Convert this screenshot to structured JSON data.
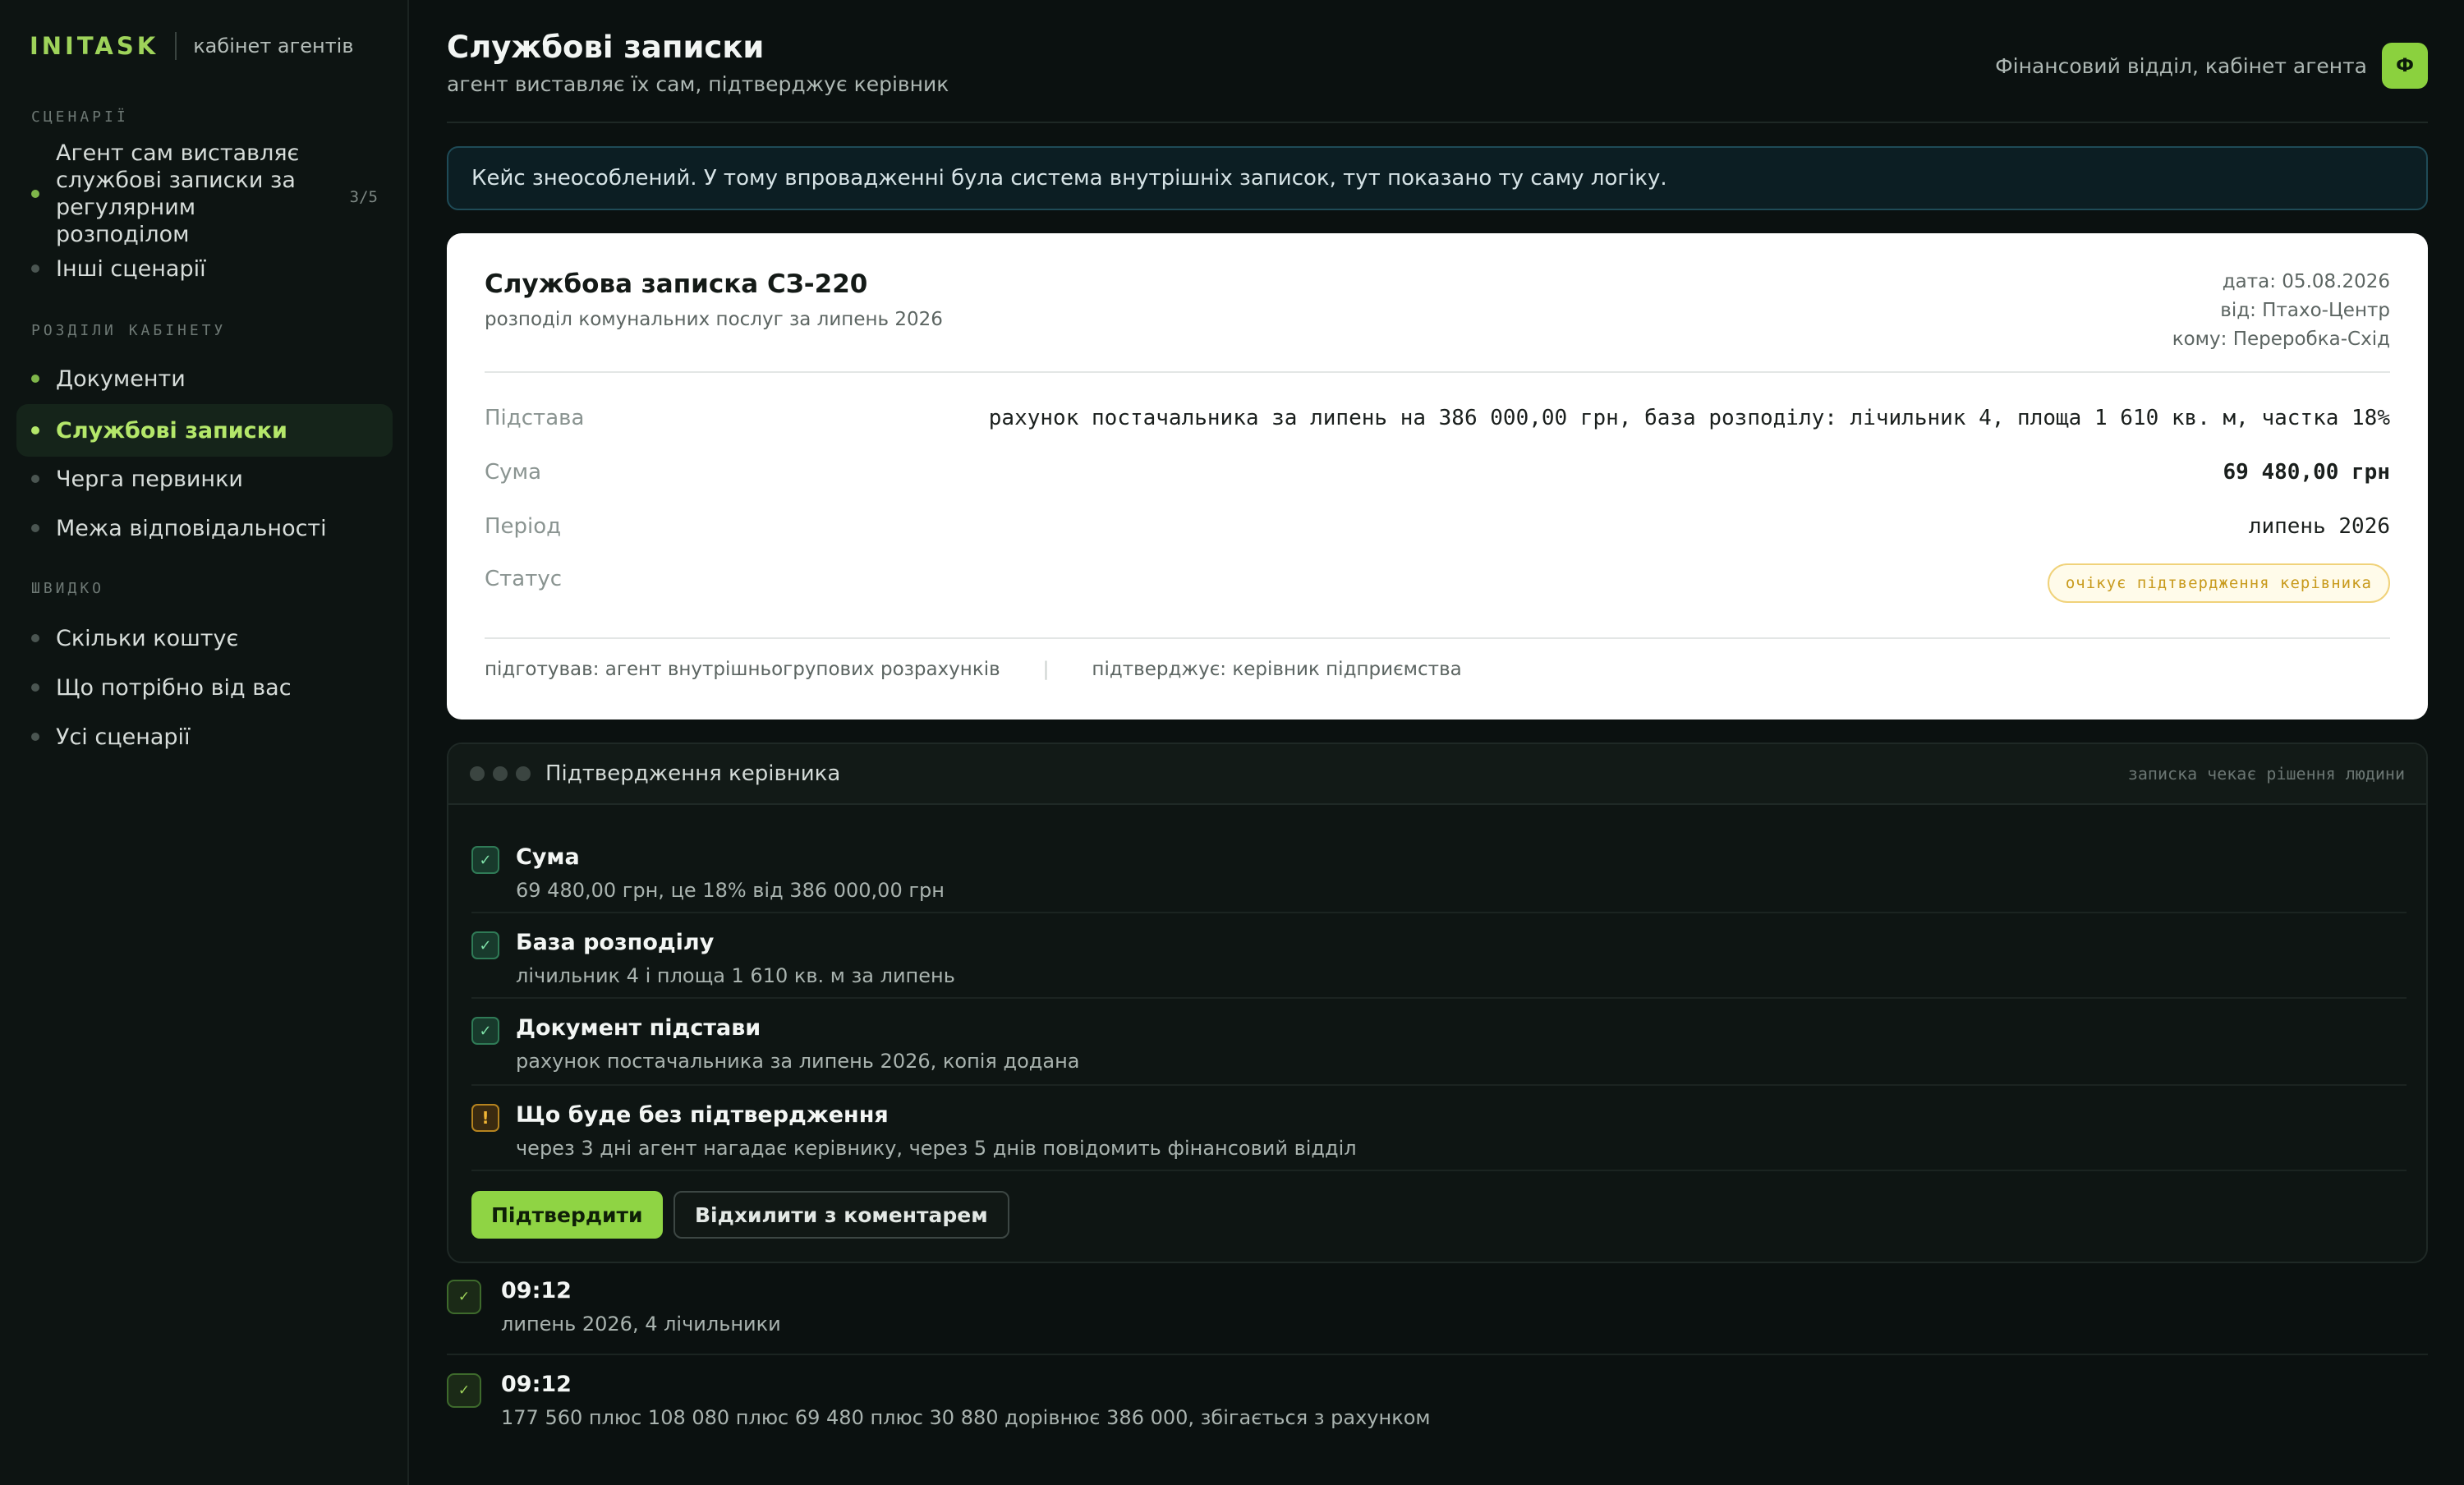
{
  "brand": {
    "logo": "INITASK",
    "subtitle": "кабінет агентів"
  },
  "sidebar": {
    "sections": [
      {
        "title": "СЦЕНАРІЇ",
        "items": [
          {
            "label": "Агент сам виставляє службові записки за регулярним розподілом",
            "count": "3/5"
          },
          {
            "label": "Інші сценарії"
          }
        ]
      },
      {
        "title": "РОЗДІЛИ КАБІНЕТУ",
        "items": [
          {
            "label": "Документи"
          },
          {
            "label": "Службові записки"
          },
          {
            "label": "Черга первинки"
          },
          {
            "label": "Межа відповідальності"
          }
        ]
      },
      {
        "title": "ШВИДКО",
        "items": [
          {
            "label": "Скільки коштує"
          },
          {
            "label": "Що потрібно від вас"
          },
          {
            "label": "Усі сценарії"
          }
        ]
      }
    ]
  },
  "header": {
    "title": "Службові записки",
    "subtitle": "агент виставляє їх сам, підтверджує керівник",
    "user_label": "Фінансовий відділ, кабінет агента",
    "avatar_letter": "Ф"
  },
  "notice": "Кейс знеособлений. У тому впровадженні була система внутрішніх записок, тут показано ту саму логіку.",
  "memo": {
    "title": "Службова записка СЗ-220",
    "subtitle": "розподіл комунальних послуг за липень 2026",
    "date": "дата: 05.08.2026",
    "from": "від: Птахо-Центр",
    "to": "кому: Переробка-Схід",
    "rows": [
      {
        "label": "Підстава",
        "value": "рахунок постачальника за липень на 386 000,00 грн, база розподілу: лічильник 4, площа 1 610 кв. м, частка 18%"
      },
      {
        "label": "Сума",
        "value": "69 480,00 грн"
      },
      {
        "label": "Період",
        "value": "липень 2026"
      },
      {
        "label": "Статус",
        "value": "очікує підтвердження керівника"
      }
    ],
    "prepared_by": "підготував: агент внутрішньогрупових розрахунків",
    "separator": "|",
    "approved_by": "підтверджує: керівник підприємства"
  },
  "approval": {
    "title": "Підтвердження керівника",
    "note": "записка чекає рішення людини",
    "checks": [
      {
        "title": "Сума",
        "desc": "69 480,00 грн, це 18% від 386 000,00 грн",
        "mark": "✓"
      },
      {
        "title": "База розподілу",
        "desc": "лічильник 4 і площа 1 610 кв. м за липень",
        "mark": "✓"
      },
      {
        "title": "Документ підстави",
        "desc": "рахунок постачальника за липень 2026, копія додана",
        "mark": "✓"
      },
      {
        "title": "Що буде без підтвердження",
        "desc": "через 3 дні агент нагадає керівнику, через 5 днів повідомить фінансовий відділ",
        "mark": "!"
      }
    ],
    "confirm_label": "Підтвердити",
    "reject_label": "Відхилити з коментарем"
  },
  "log": [
    {
      "mark": "✓",
      "time": "09:12",
      "desc": "липень 2026, 4 лічильники"
    },
    {
      "mark": "✓",
      "time": "09:12",
      "desc": "177 560 плюс 108 080 плюс 69 480 плюс 30 880 дорівнює 386 000, збігається з рахунком"
    }
  ],
  "colors": {
    "accent": "#8fd444",
    "warning": "#f1b534",
    "background": "#0b1110"
  }
}
